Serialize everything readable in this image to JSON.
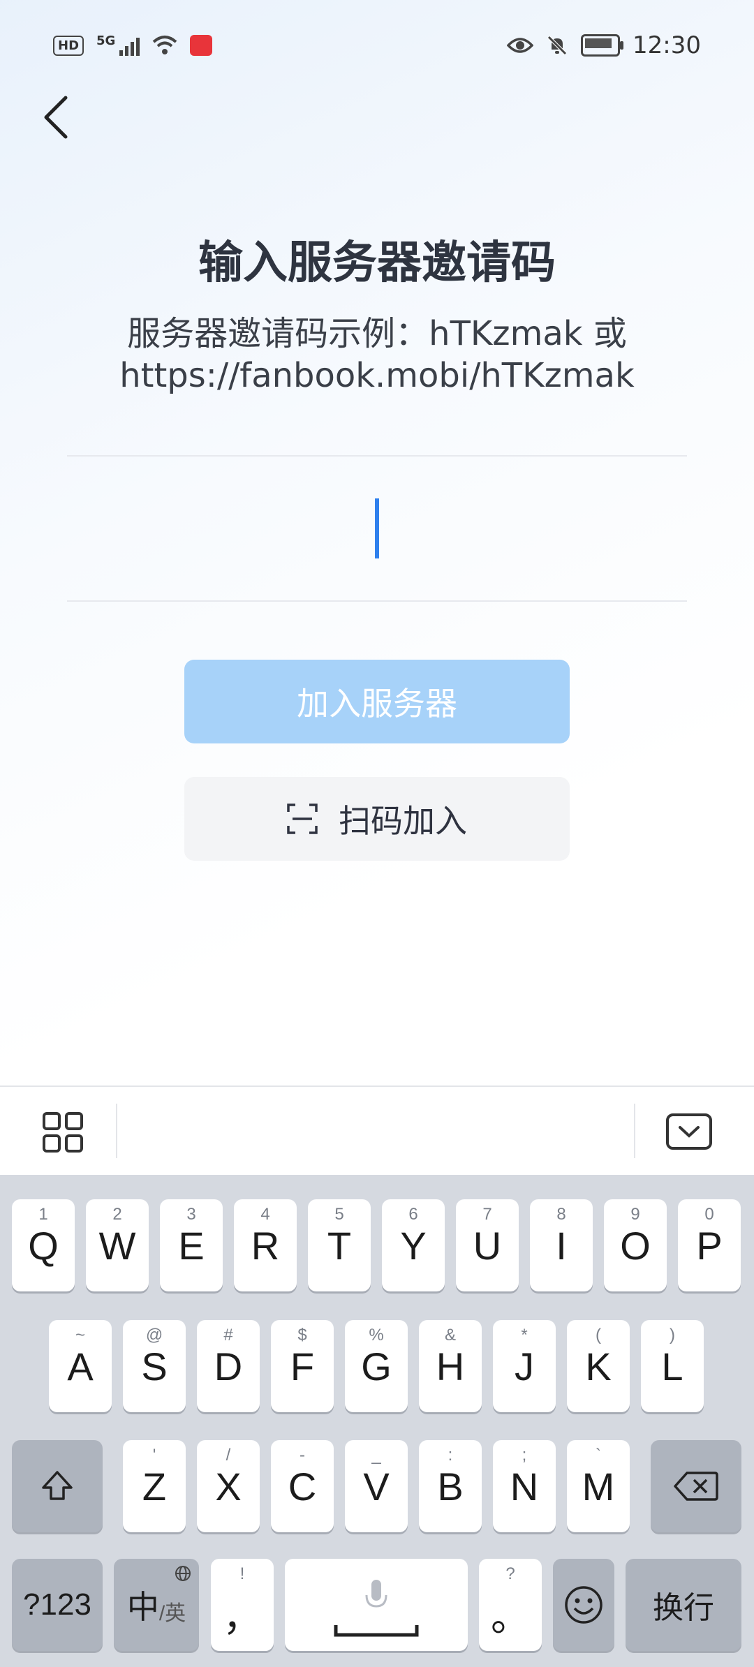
{
  "status_bar": {
    "time": "12:30",
    "network": "5G",
    "hd": "HD"
  },
  "page": {
    "title": "输入服务器邀请码",
    "subtitle_line1": "服务器邀请码示例：hTKzmak 或",
    "subtitle_line2": "https://fanbook.mobi/hTKzmak",
    "input_value": "",
    "join_button": "加入服务器",
    "scan_button": "扫码加入"
  },
  "keyboard": {
    "row1": [
      {
        "k": "Q",
        "s": "1"
      },
      {
        "k": "W",
        "s": "2"
      },
      {
        "k": "E",
        "s": "3"
      },
      {
        "k": "R",
        "s": "4"
      },
      {
        "k": "T",
        "s": "5"
      },
      {
        "k": "Y",
        "s": "6"
      },
      {
        "k": "U",
        "s": "7"
      },
      {
        "k": "I",
        "s": "8"
      },
      {
        "k": "O",
        "s": "9"
      },
      {
        "k": "P",
        "s": "0"
      }
    ],
    "row2": [
      {
        "k": "A",
        "s": "~"
      },
      {
        "k": "S",
        "s": "@"
      },
      {
        "k": "D",
        "s": "#"
      },
      {
        "k": "F",
        "s": "$"
      },
      {
        "k": "G",
        "s": "%"
      },
      {
        "k": "H",
        "s": "&"
      },
      {
        "k": "J",
        "s": "*"
      },
      {
        "k": "K",
        "s": "("
      },
      {
        "k": "L",
        "s": ")"
      }
    ],
    "row3": [
      {
        "k": "Z",
        "s": "'"
      },
      {
        "k": "X",
        "s": "/"
      },
      {
        "k": "C",
        "s": "-"
      },
      {
        "k": "V",
        "s": "_"
      },
      {
        "k": "B",
        "s": ":"
      },
      {
        "k": "N",
        "s": ";"
      },
      {
        "k": "M",
        "s": "`"
      }
    ],
    "numbers_key": "?123",
    "lang_key_main": "中",
    "lang_key_sub": "/英",
    "comma_key": "，",
    "comma_sup": "!",
    "period_key": "。",
    "period_sup": "?",
    "enter_key": "换行"
  }
}
